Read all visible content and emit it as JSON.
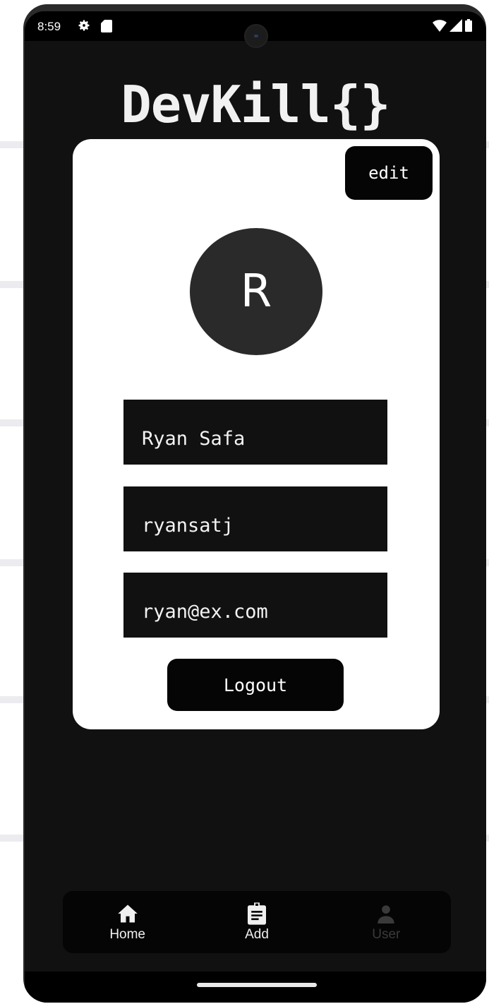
{
  "status_bar": {
    "time": "8:59",
    "icons_left": [
      "gear-icon",
      "sd-card-icon"
    ],
    "icons_right": [
      "wifi-icon",
      "signal-icon",
      "battery-icon"
    ]
  },
  "app": {
    "title": "DevKill{}"
  },
  "profile_card": {
    "edit_label": "edit",
    "avatar_initial": "R",
    "fields": {
      "name": "Ryan Safa",
      "username": "ryansatj",
      "email": "ryan@ex.com"
    },
    "logout_label": "Logout"
  },
  "bottom_nav": {
    "items": [
      {
        "label": "Home",
        "icon": "home-icon",
        "active": true
      },
      {
        "label": "Add",
        "icon": "clipboard-icon",
        "active": true
      },
      {
        "label": "User",
        "icon": "user-icon",
        "active": false
      }
    ]
  },
  "colors": {
    "background": "#111111",
    "card": "#ffffff",
    "button": "#050505",
    "avatar": "#2a2a2a",
    "nav_inactive": "#3a3a3a"
  }
}
